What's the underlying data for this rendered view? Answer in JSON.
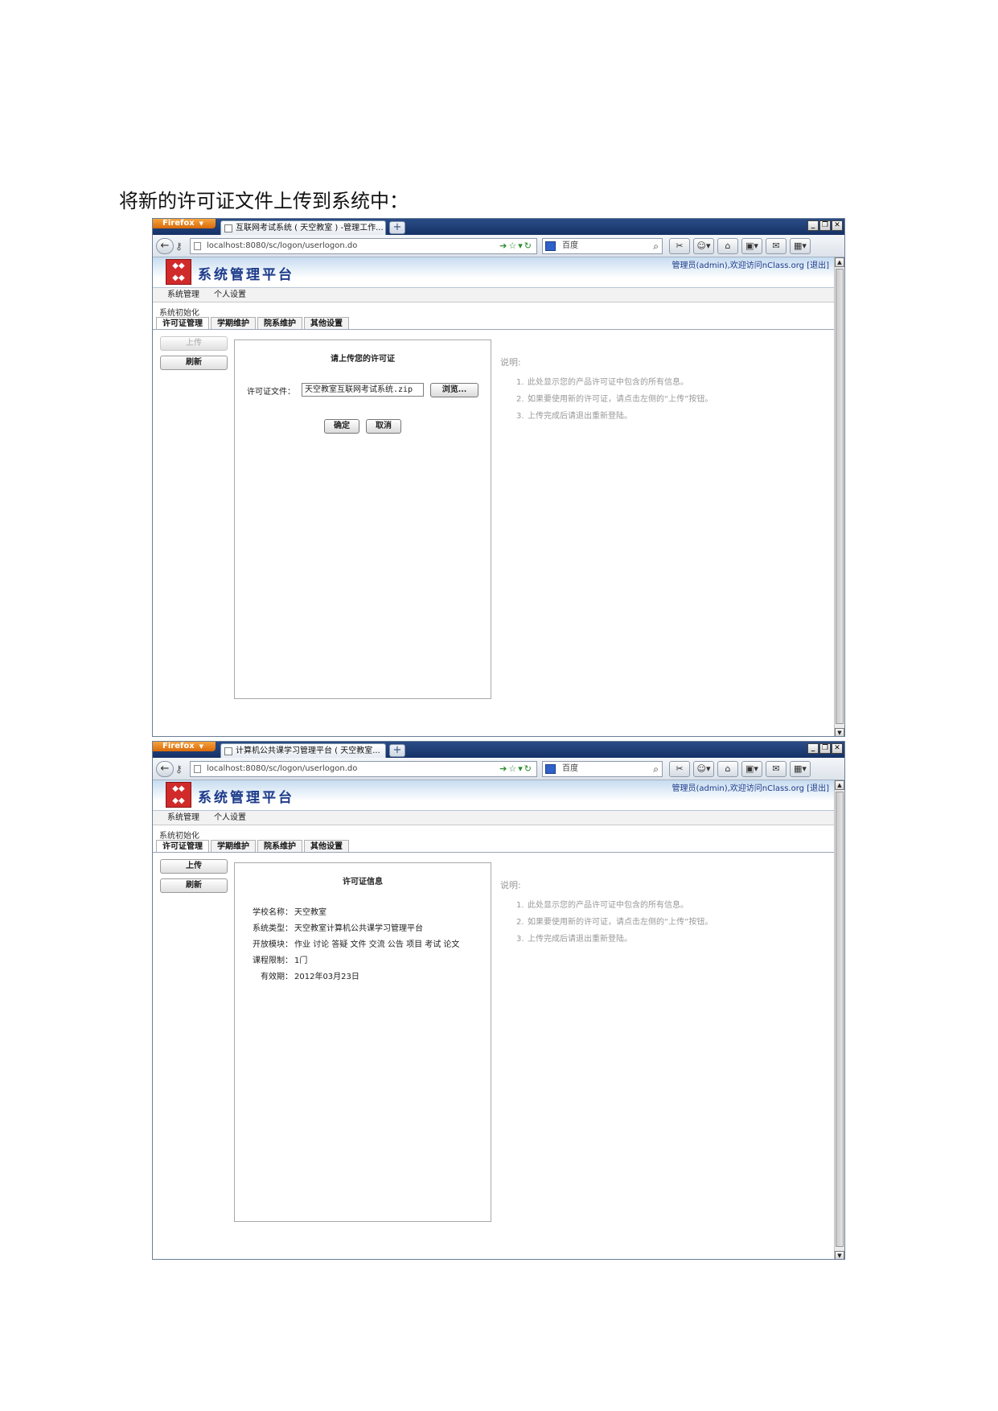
{
  "heading": "将新的许可证文件上传到系统中：",
  "windows": [
    {
      "firefox_label": "Firefox",
      "tab_title": "互联网考试系统 ( 天空教室 ) -管理工作...",
      "url": "localhost:8080/sc/logon/userlogon.do",
      "search_engine": "百度",
      "app_title": "系统管理平台",
      "welcome": "管理员(admin),欢迎访问nClass.org [退出]",
      "menu": [
        "系统管理",
        "个人设置"
      ],
      "breadcrumb": "系统初始化",
      "tabs": [
        "许可证管理",
        "学期维护",
        "院系维护",
        "其他设置"
      ],
      "upload_label": "上传",
      "upload_disabled": true,
      "refresh_label": "刷新",
      "panel_title": "请上传您的许可证",
      "file_label": "许可证文件：",
      "file_value": "天空教室互联网考试系统.zip",
      "browse_label": "浏览...",
      "confirm_label": "确定",
      "cancel_label": "取消",
      "notes_title": "说明:",
      "notes": [
        "此处显示您的产品许可证中包含的所有信息。",
        "如果要使用新的许可证，请点击左侧的“上传”按钮。",
        "上传完成后请退出重新登陆。"
      ]
    },
    {
      "firefox_label": "Firefox",
      "tab_title": "计算机公共课学习管理平台 ( 天空教室...",
      "url": "localhost:8080/sc/logon/userlogon.do",
      "search_engine": "百度",
      "app_title": "系统管理平台",
      "welcome": "管理员(admin),欢迎访问nClass.org [退出]",
      "menu": [
        "系统管理",
        "个人设置"
      ],
      "breadcrumb": "系统初始化",
      "tabs": [
        "许可证管理",
        "学期维护",
        "院系维护",
        "其他设置"
      ],
      "upload_label": "上传",
      "upload_disabled": false,
      "refresh_label": "刷新",
      "panel_title": "许可证信息",
      "info": [
        {
          "key": "学校名称：",
          "value": "天空教室"
        },
        {
          "key": "系统类型：",
          "value": "天空教室计算机公共课学习管理平台"
        },
        {
          "key": "开放模块：",
          "value": "作业 讨论 答疑 文件 交流 公告 项目 考试 论文"
        },
        {
          "key": "课程限制：",
          "value": "1门"
        },
        {
          "key": "有效期：",
          "value": "2012年03月23日"
        }
      ],
      "notes_title": "说明:",
      "notes": [
        "此处显示您的产品许可证中包含的所有信息。",
        "如果要使用新的许可证，请点击左侧的“上传”按钮。",
        "上传完成后请退出重新登陆。"
      ]
    }
  ]
}
